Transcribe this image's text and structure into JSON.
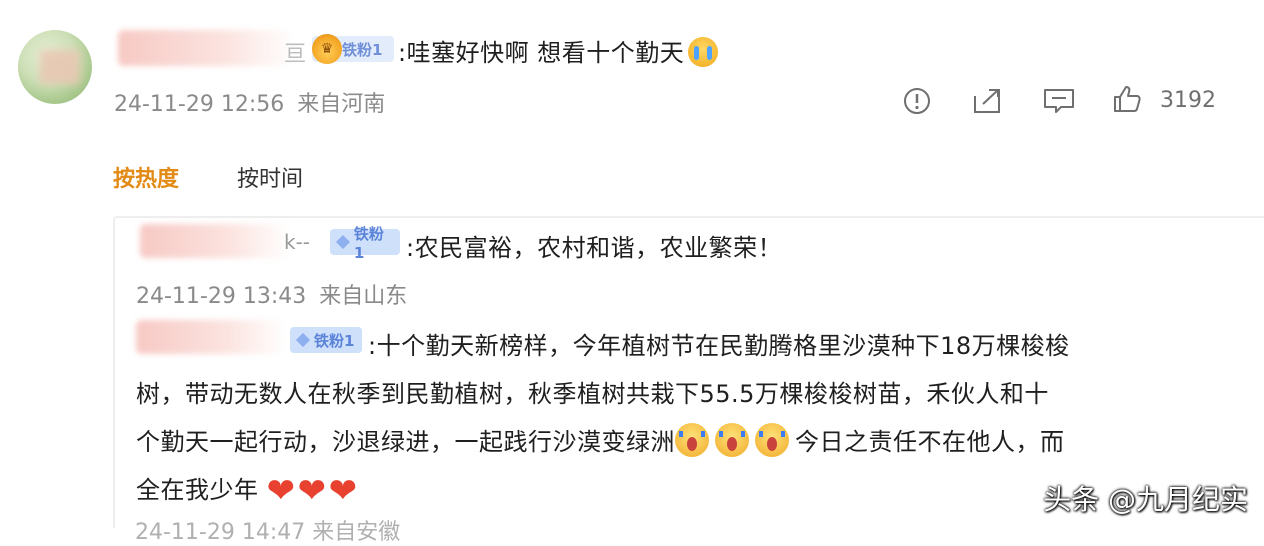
{
  "top_comment": {
    "badge": "铁粉1",
    "text": ":哇塞好快啊 想看十个勤天",
    "date": "24-11-29 12:56",
    "location": "来自河南",
    "like_count": "3192"
  },
  "sort": {
    "hot": "按热度",
    "time": "按时间"
  },
  "replies": [
    {
      "name_tail": "k--",
      "badge": "铁粉1",
      "text": ":农民富裕，农村和谐，农业繁荣！",
      "date": "24-11-29 13:43",
      "location": "来自山东"
    },
    {
      "badge": "铁粉1",
      "text_line1": ":十个勤天新榜样，今年植树节在民勤腾格里沙漠种下18万棵梭梭",
      "text_line2": "树，带动无数人在秋季到民勤植树，秋季植树共栽下55.5万棵梭梭树苗，禾伙人和十",
      "text_line3a": "个勤天一起行动，沙退绿进，一起践行沙漠变绿洲",
      "text_line3b": "今日之责任不在他人，而",
      "text_line4": "全在我少年",
      "cut_meta": "24-11-29 14:47 来自安徽"
    }
  ],
  "watermark": "头条 @九月纪实",
  "icons": [
    "report-icon",
    "share-icon",
    "comment-icon",
    "like-icon",
    "crown-icon",
    "diamond-icon",
    "cry-emoji",
    "scream-emoji",
    "heart-emoji"
  ],
  "colors": {
    "accent_orange": "#e38a15",
    "heart_red": "#e8412f",
    "badge_blue": "#cfe0fb",
    "meta_gray": "#8a8a8a"
  }
}
